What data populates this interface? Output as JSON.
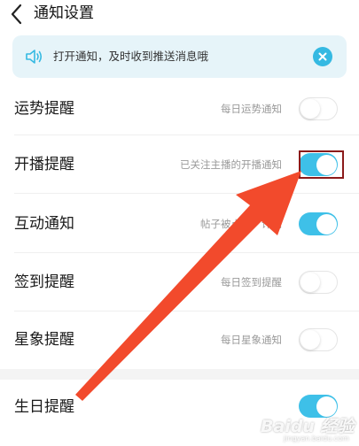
{
  "header": {
    "title": "通知设置"
  },
  "banner": {
    "text": "打开通知，及时收到推送消息哦"
  },
  "settings": [
    {
      "label": "运势提醒",
      "description": "每日运势通知",
      "enabled": false
    },
    {
      "label": "开播提醒",
      "description": "已关注主播的开播通知",
      "enabled": true
    },
    {
      "label": "互动通知",
      "description": "帖子被点赞、评论",
      "enabled": true
    },
    {
      "label": "签到提醒",
      "description": "每日签到提醒",
      "enabled": false
    },
    {
      "label": "星象提醒",
      "description": "每日星象通知",
      "enabled": false
    },
    {
      "label": "生日提醒",
      "description": "",
      "enabled": true
    }
  ],
  "watermark": {
    "logo": "Baidu 经验",
    "url": "jingyan.baidu.com"
  },
  "colors": {
    "accent": "#3ec0e8",
    "annotation_arrow": "#f24a2c",
    "highlight_box": "#8b1a1a"
  }
}
